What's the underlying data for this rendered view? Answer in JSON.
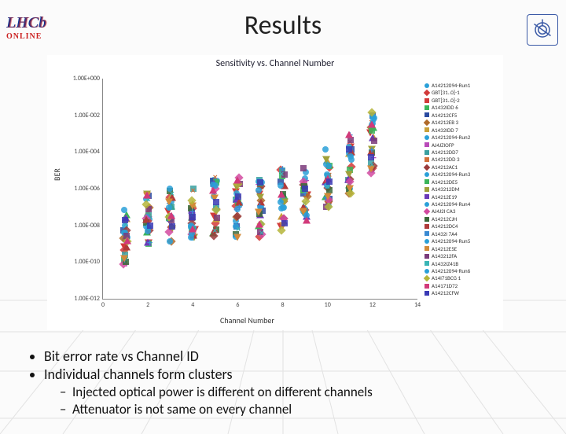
{
  "slide": {
    "title": "Results",
    "bullets": [
      "Bit error rate vs Channel ID",
      "Individual channels form clusters"
    ],
    "sub_bullets": [
      "Injected optical power is different on different channels",
      "Attenuator is not same on every channel"
    ]
  },
  "logos": {
    "lhcb_text": "LHCb",
    "lhcb_online": "ONLINE",
    "cern_name": "cern-logo"
  },
  "chart_data": {
    "type": "scatter",
    "title": "Sensitivity vs. Channel Number",
    "xlabel": "Channel Number",
    "ylabel": "BER",
    "xlim": [
      0,
      14
    ],
    "x_ticks": [
      0,
      2,
      4,
      6,
      8,
      10,
      12,
      14
    ],
    "y_ticks": [
      "1.00E+000",
      "1.00E-002",
      "1.00E-004",
      "1.00E-006",
      "1.00E-008",
      "1.00E-010",
      "1.00E-012"
    ],
    "y_exp_range": [
      0,
      -12
    ],
    "series": [
      {
        "name": "A14212094-Run1",
        "color": "#2aa0d8",
        "marker": "circ"
      },
      {
        "name": "GBT[31..0]-1",
        "color": "#d23a3a",
        "marker": "dia"
      },
      {
        "name": "GBT[31..0]-2",
        "color": "#d23a3a",
        "marker": "tridn"
      },
      {
        "name": "A1432IDD 6",
        "color": "#3bb55a",
        "marker": "triup"
      },
      {
        "name": "A14212CF5",
        "color": "#2a4aa0",
        "marker": "sq"
      },
      {
        "name": "A14212EB 3",
        "color": "#b06a2a",
        "marker": "dia"
      },
      {
        "name": "A1432IDD 7",
        "color": "#c9a13a",
        "marker": "triup"
      },
      {
        "name": "A14212094-Run2",
        "color": "#2aa0d8",
        "marker": "circ"
      },
      {
        "name": "AJ4JZIOFP",
        "color": "#b94ab9",
        "marker": "plus"
      },
      {
        "name": "A14212DD7",
        "color": "#3aa0a0",
        "marker": "sq"
      },
      {
        "name": "A14212DD 3",
        "color": "#d2703a",
        "marker": "x"
      },
      {
        "name": "A14212AC1",
        "color": "#9a3a3a",
        "marker": "dia"
      },
      {
        "name": "A14212094-Run3",
        "color": "#2aa0d8",
        "marker": "circ"
      },
      {
        "name": "A14212DE5",
        "color": "#3bb55a",
        "marker": "sq"
      },
      {
        "name": "A143212DM",
        "color": "#a0a03a",
        "marker": "tridn"
      },
      {
        "name": "A14212E19",
        "color": "#6a3ab9",
        "marker": "triup"
      },
      {
        "name": "A14212094-Run4",
        "color": "#2aa0d8",
        "marker": "circ"
      },
      {
        "name": "AJ4J2I CA3",
        "color": "#d24aa0",
        "marker": "dia"
      },
      {
        "name": "A14212CJH",
        "color": "#3a6a3a",
        "marker": "sq"
      },
      {
        "name": "A14212DC4",
        "color": "#b03a3a",
        "marker": "triup"
      },
      {
        "name": "A1432I 7A4",
        "color": "#3a8ad2",
        "marker": "plus"
      },
      {
        "name": "A14212094-Run5",
        "color": "#2aa0d8",
        "marker": "circ"
      },
      {
        "name": "A14212E5E",
        "color": "#d28a3a",
        "marker": "tridn"
      },
      {
        "name": "A143212FA",
        "color": "#7a3a7a",
        "marker": "sq"
      },
      {
        "name": "A1432IZ41B",
        "color": "#3ab5b5",
        "marker": "x"
      },
      {
        "name": "A14212094-Run6",
        "color": "#2aa0d8",
        "marker": "circ"
      },
      {
        "name": "A14I71BCG 1",
        "color": "#b5b53a",
        "marker": "dia"
      },
      {
        "name": "A14171D72",
        "color": "#d23a7a",
        "marker": "triup"
      },
      {
        "name": "A14212CFW",
        "color": "#3a3ab5",
        "marker": "sq"
      }
    ],
    "clusters": [
      {
        "x": 1,
        "y_exp_min": -10.2,
        "y_exp_max": -7.0
      },
      {
        "x": 2,
        "y_exp_min": -9.2,
        "y_exp_max": -6.2
      },
      {
        "x": 3,
        "y_exp_min": -9.0,
        "y_exp_max": -5.8
      },
      {
        "x": 4,
        "y_exp_min": -9.2,
        "y_exp_max": -6.0
      },
      {
        "x": 5,
        "y_exp_min": -8.6,
        "y_exp_max": -5.2
      },
      {
        "x": 6,
        "y_exp_min": -8.8,
        "y_exp_max": -5.3
      },
      {
        "x": 7,
        "y_exp_min": -8.7,
        "y_exp_max": -5.4
      },
      {
        "x": 8,
        "y_exp_min": -8.3,
        "y_exp_max": -4.8
      },
      {
        "x": 9,
        "y_exp_min": -7.8,
        "y_exp_max": -4.2
      },
      {
        "x": 10,
        "y_exp_min": -7.0,
        "y_exp_max": -3.8
      },
      {
        "x": 11,
        "y_exp_min": -6.3,
        "y_exp_max": -3.0
      },
      {
        "x": 12,
        "y_exp_min": -5.2,
        "y_exp_max": -1.8
      }
    ]
  }
}
